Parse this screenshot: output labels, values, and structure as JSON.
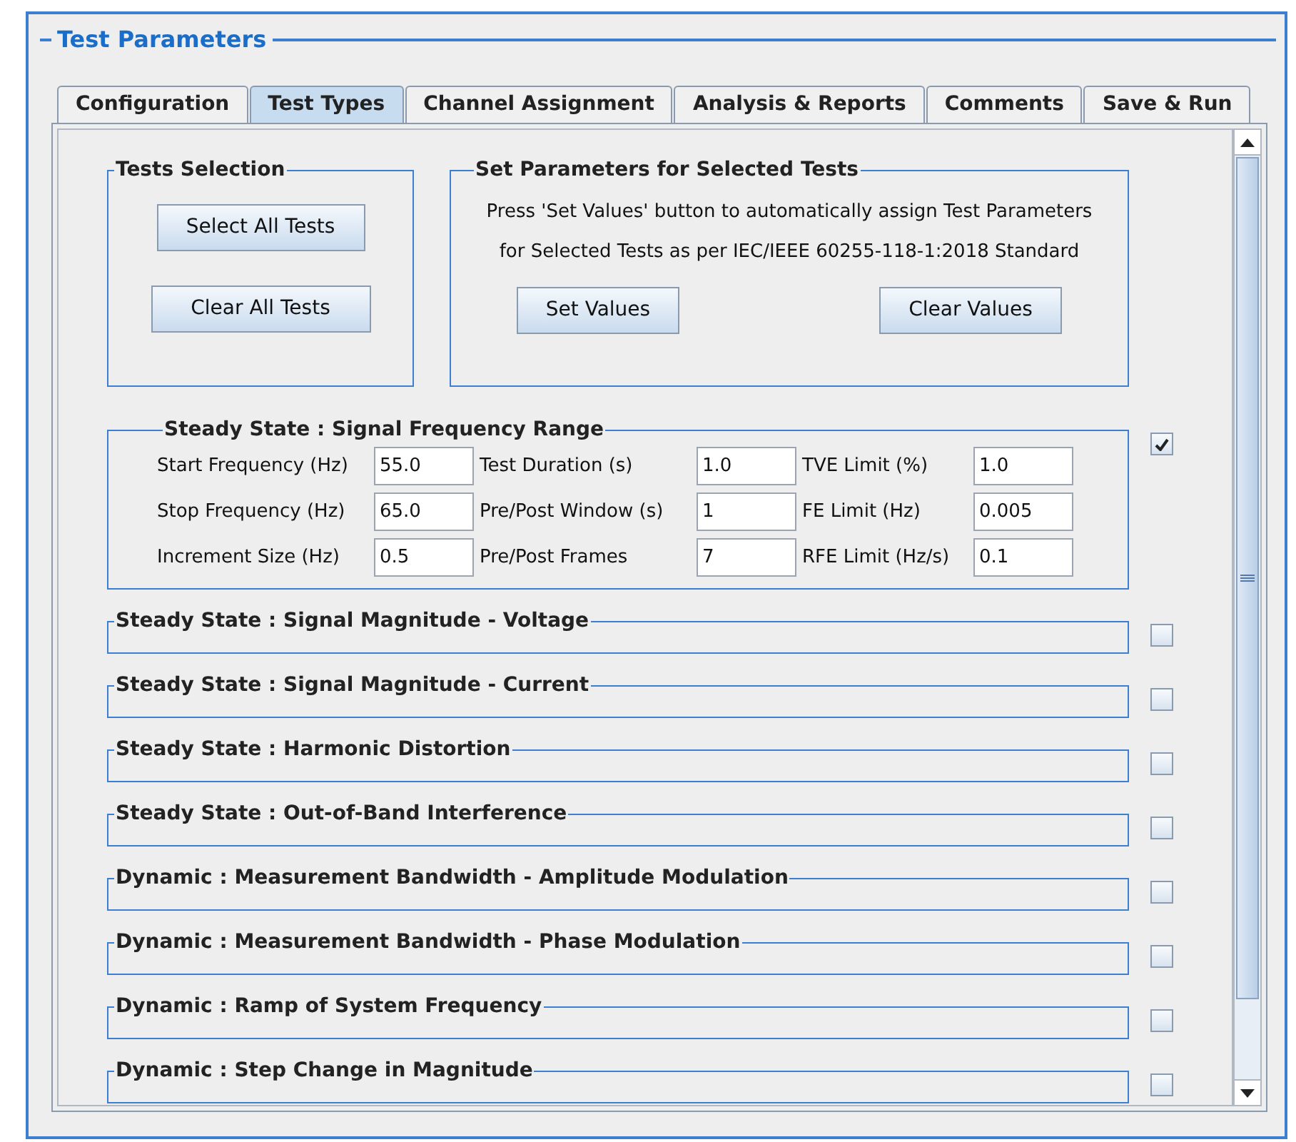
{
  "panel": {
    "title": "Test Parameters"
  },
  "tabs": [
    {
      "label": "Configuration",
      "selected": false
    },
    {
      "label": "Test Types",
      "selected": true
    },
    {
      "label": "Channel Assignment",
      "selected": false
    },
    {
      "label": "Analysis & Reports",
      "selected": false
    },
    {
      "label": "Comments",
      "selected": false
    },
    {
      "label": "Save & Run",
      "selected": false
    }
  ],
  "tests_selection": {
    "title": "Tests Selection",
    "buttons": [
      "Select All Tests",
      "Clear All Tests"
    ]
  },
  "set_parameters": {
    "title": "Set Parameters for Selected Tests",
    "description": [
      "Press 'Set Values' button to automatically assign Test Parameters",
      "for Selected Tests as per IEC/IEEE 60255-118-1:2018 Standard"
    ],
    "buttons": [
      "Set Values",
      "Clear Values"
    ]
  },
  "tests": [
    {
      "title": "Steady State : Signal Frequency Range",
      "checked": true,
      "fields": [
        {
          "label": "Start Frequency (Hz)",
          "value": "55.0"
        },
        {
          "label": "Test Duration (s)",
          "value": "1.0"
        },
        {
          "label": "TVE Limit (%)",
          "value": "1.0"
        },
        {
          "label": "Stop Frequency (Hz)",
          "value": "65.0"
        },
        {
          "label": "Pre/Post Window (s)",
          "value": "1"
        },
        {
          "label": "FE Limit (Hz)",
          "value": "0.005"
        },
        {
          "label": "Increment Size (Hz)",
          "value": "0.5"
        },
        {
          "label": "Pre/Post Frames",
          "value": "7"
        },
        {
          "label": "RFE Limit (Hz/s)",
          "value": "0.1"
        }
      ]
    },
    {
      "title": "Steady State : Signal Magnitude - Voltage",
      "checked": false
    },
    {
      "title": "Steady State : Signal Magnitude - Current",
      "checked": false
    },
    {
      "title": "Steady State : Harmonic Distortion",
      "checked": false
    },
    {
      "title": "Steady State : Out-of-Band Interference",
      "checked": false
    },
    {
      "title": "Dynamic : Measurement Bandwidth - Amplitude Modulation",
      "checked": false
    },
    {
      "title": "Dynamic : Measurement Bandwidth - Phase Modulation",
      "checked": false
    },
    {
      "title": "Dynamic : Ramp of System Frequency",
      "checked": false
    },
    {
      "title": "Dynamic : Step Change in Magnitude",
      "checked": false
    }
  ]
}
